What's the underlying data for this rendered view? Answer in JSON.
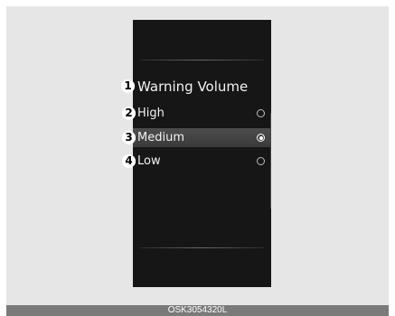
{
  "screen": {
    "title": "Warning Volume",
    "title_number": "1",
    "options": [
      {
        "number": "2",
        "label": "High",
        "selected": false
      },
      {
        "number": "3",
        "label": "Medium",
        "selected": true
      },
      {
        "number": "4",
        "label": "Low",
        "selected": false
      }
    ]
  },
  "caption": "OSK3054320L",
  "colors": {
    "screen_background": "#161616",
    "selected_row": "#474747",
    "frame_background": "#e6e6e6",
    "caption_bar": "#7a7a7a"
  }
}
